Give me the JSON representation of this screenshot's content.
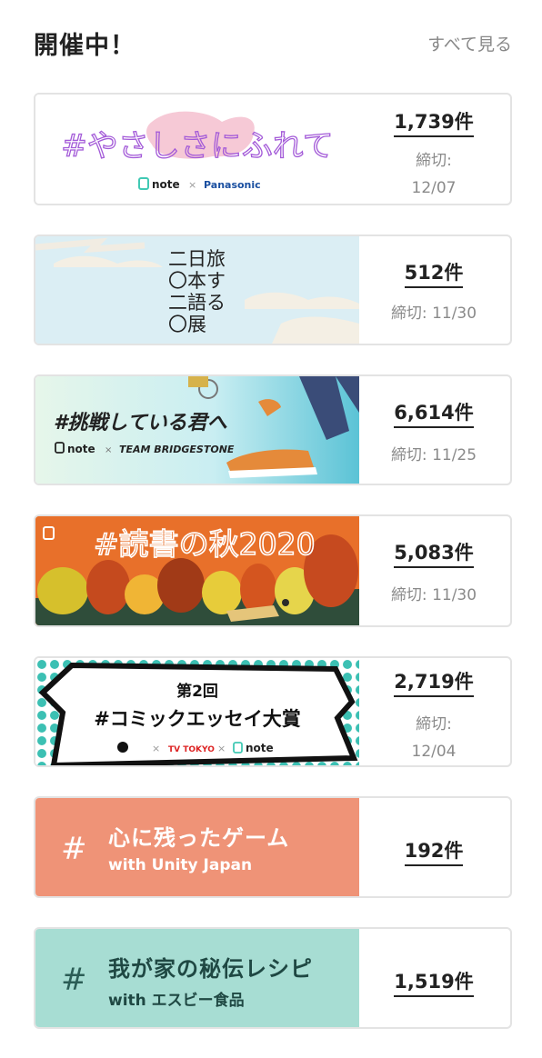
{
  "header": {
    "title": "開催中！",
    "see_all": "すべて見る"
  },
  "contests": [
    {
      "banner_title": "#やさしさにふれて",
      "brand_left": "note",
      "brand_sep": "×",
      "brand_right": "Panasonic",
      "count": "1,739件",
      "deadline_label": "締切:",
      "deadline_date": "12/07"
    },
    {
      "banner_lines": [
        "二日旅",
        "〇本す",
        "二語る",
        "〇展"
      ],
      "count": "512件",
      "deadline": "締切: 11/30"
    },
    {
      "banner_title": "#挑戦している君へ",
      "brand_left": "note",
      "brand_sep": "×",
      "brand_right": "TEAM BRIDGESTONE",
      "count": "6,614件",
      "deadline": "締切: 11/25"
    },
    {
      "banner_title": "#読書の秋2020",
      "count": "5,083件",
      "deadline": "締切: 11/30"
    },
    {
      "banner_badge": "第2回",
      "banner_title": "#コミックエッセイ大賞",
      "brand_mid": "TV TOKYO",
      "brand_right": "note",
      "brand_sep": "×",
      "count": "2,719件",
      "deadline_label": "締切:",
      "deadline_date": "12/04"
    },
    {
      "hash": "#",
      "title": "心に残ったゲーム",
      "subtitle": "with Unity Japan",
      "count": "192件",
      "color": "#ef9377"
    },
    {
      "hash": "#",
      "title": "我が家の秘伝レシピ",
      "subtitle": "with エスビー食品",
      "count": "1,519件",
      "color": "#a7ddd3"
    }
  ]
}
